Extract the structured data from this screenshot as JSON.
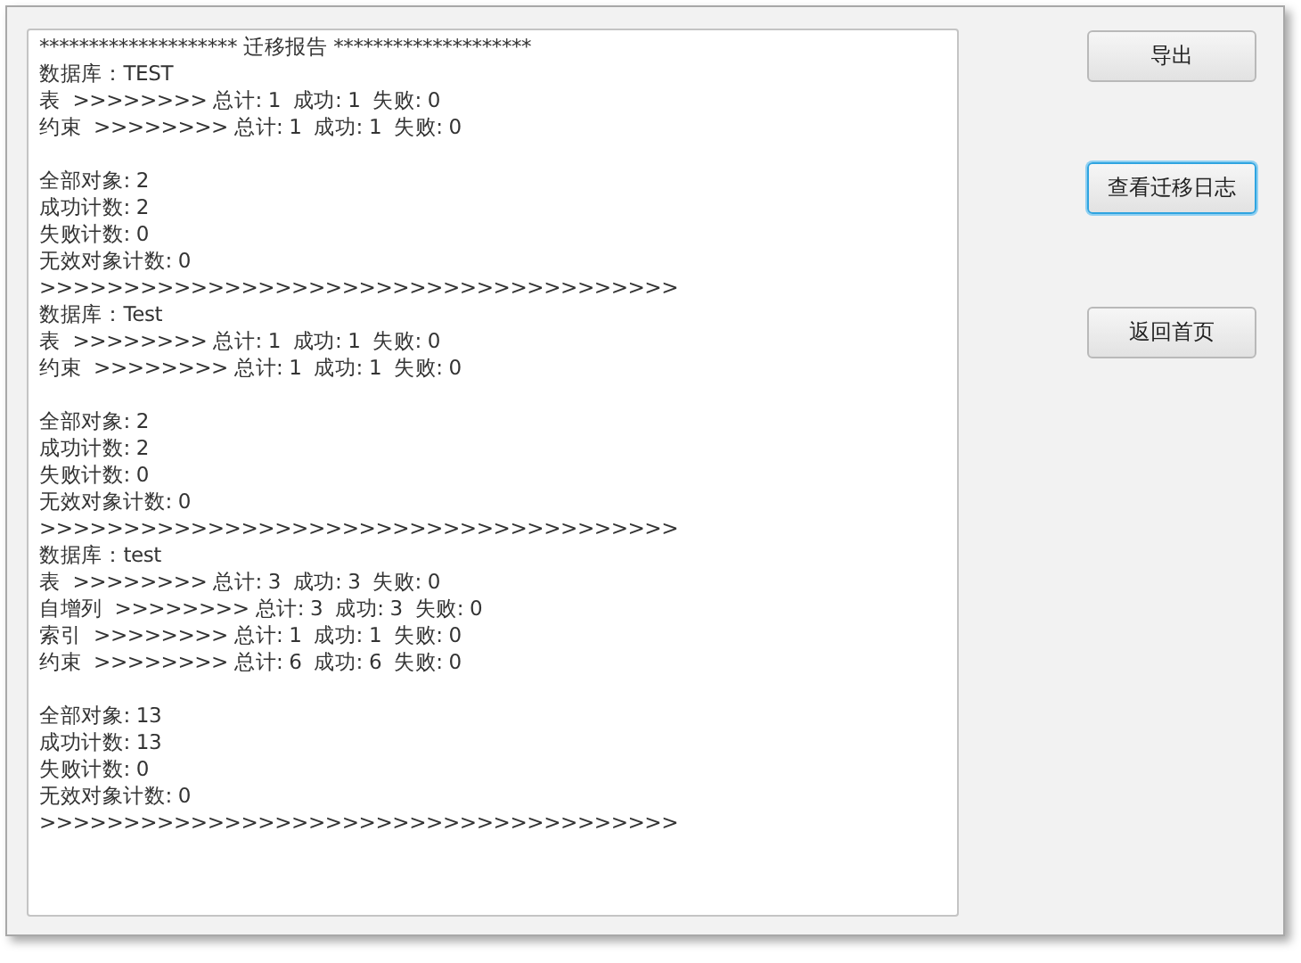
{
  "report": {
    "header": "******************** 迁移报告 ********************",
    "blocks": [
      [
        "数据库：TEST",
        "表  >>>>>>>> 总计: 1  成功: 1  失败: 0",
        "约束  >>>>>>>> 总计: 1  成功: 1  失败: 0"
      ],
      [
        "全部对象: 2",
        "成功计数: 2",
        "失败计数: 0",
        "无效对象计数: 0",
        ">>>>>>>>>>>>>>>>>>>>>>>>>>>>>>>>>>>>>>",
        "数据库：Test",
        "表  >>>>>>>> 总计: 1  成功: 1  失败: 0",
        "约束  >>>>>>>> 总计: 1  成功: 1  失败: 0"
      ],
      [
        "全部对象: 2",
        "成功计数: 2",
        "失败计数: 0",
        "无效对象计数: 0",
        ">>>>>>>>>>>>>>>>>>>>>>>>>>>>>>>>>>>>>>",
        "数据库：test",
        "表  >>>>>>>> 总计: 3  成功: 3  失败: 0",
        "自增列  >>>>>>>> 总计: 3  成功: 3  失败: 0",
        "索引  >>>>>>>> 总计: 1  成功: 1  失败: 0",
        "约束  >>>>>>>> 总计: 6  成功: 6  失败: 0"
      ],
      [
        "全部对象: 13",
        "成功计数: 13",
        "失败计数: 0",
        "无效对象计数: 0",
        ">>>>>>>>>>>>>>>>>>>>>>>>>>>>>>>>>>>>>>"
      ]
    ]
  },
  "buttons": [
    {
      "label": "导出",
      "focused": false
    },
    {
      "label": "查看迁移日志",
      "focused": true
    },
    {
      "label": "返回首页",
      "focused": false
    }
  ]
}
